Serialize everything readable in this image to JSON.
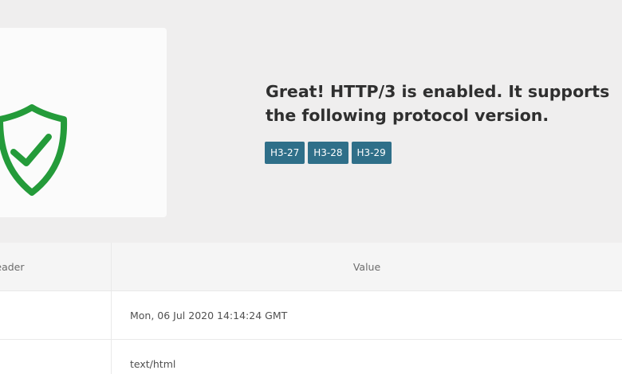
{
  "status": {
    "message": "Great! HTTP/3 is enabled. It supports the following protocol version.",
    "badges": [
      "H3-27",
      "H3-28",
      "H3-29"
    ]
  },
  "table": {
    "headers": [
      "Header",
      "Value"
    ],
    "rows": [
      {
        "header": "",
        "value": "Mon, 06 Jul 2020 14:14:24 GMT"
      },
      {
        "header": "",
        "value": "text/html"
      }
    ]
  },
  "icons": {
    "shield": "shield-check-icon"
  },
  "colors": {
    "accent": "#2f6f89",
    "success": "#249b3a",
    "banner": "#efeeee"
  }
}
